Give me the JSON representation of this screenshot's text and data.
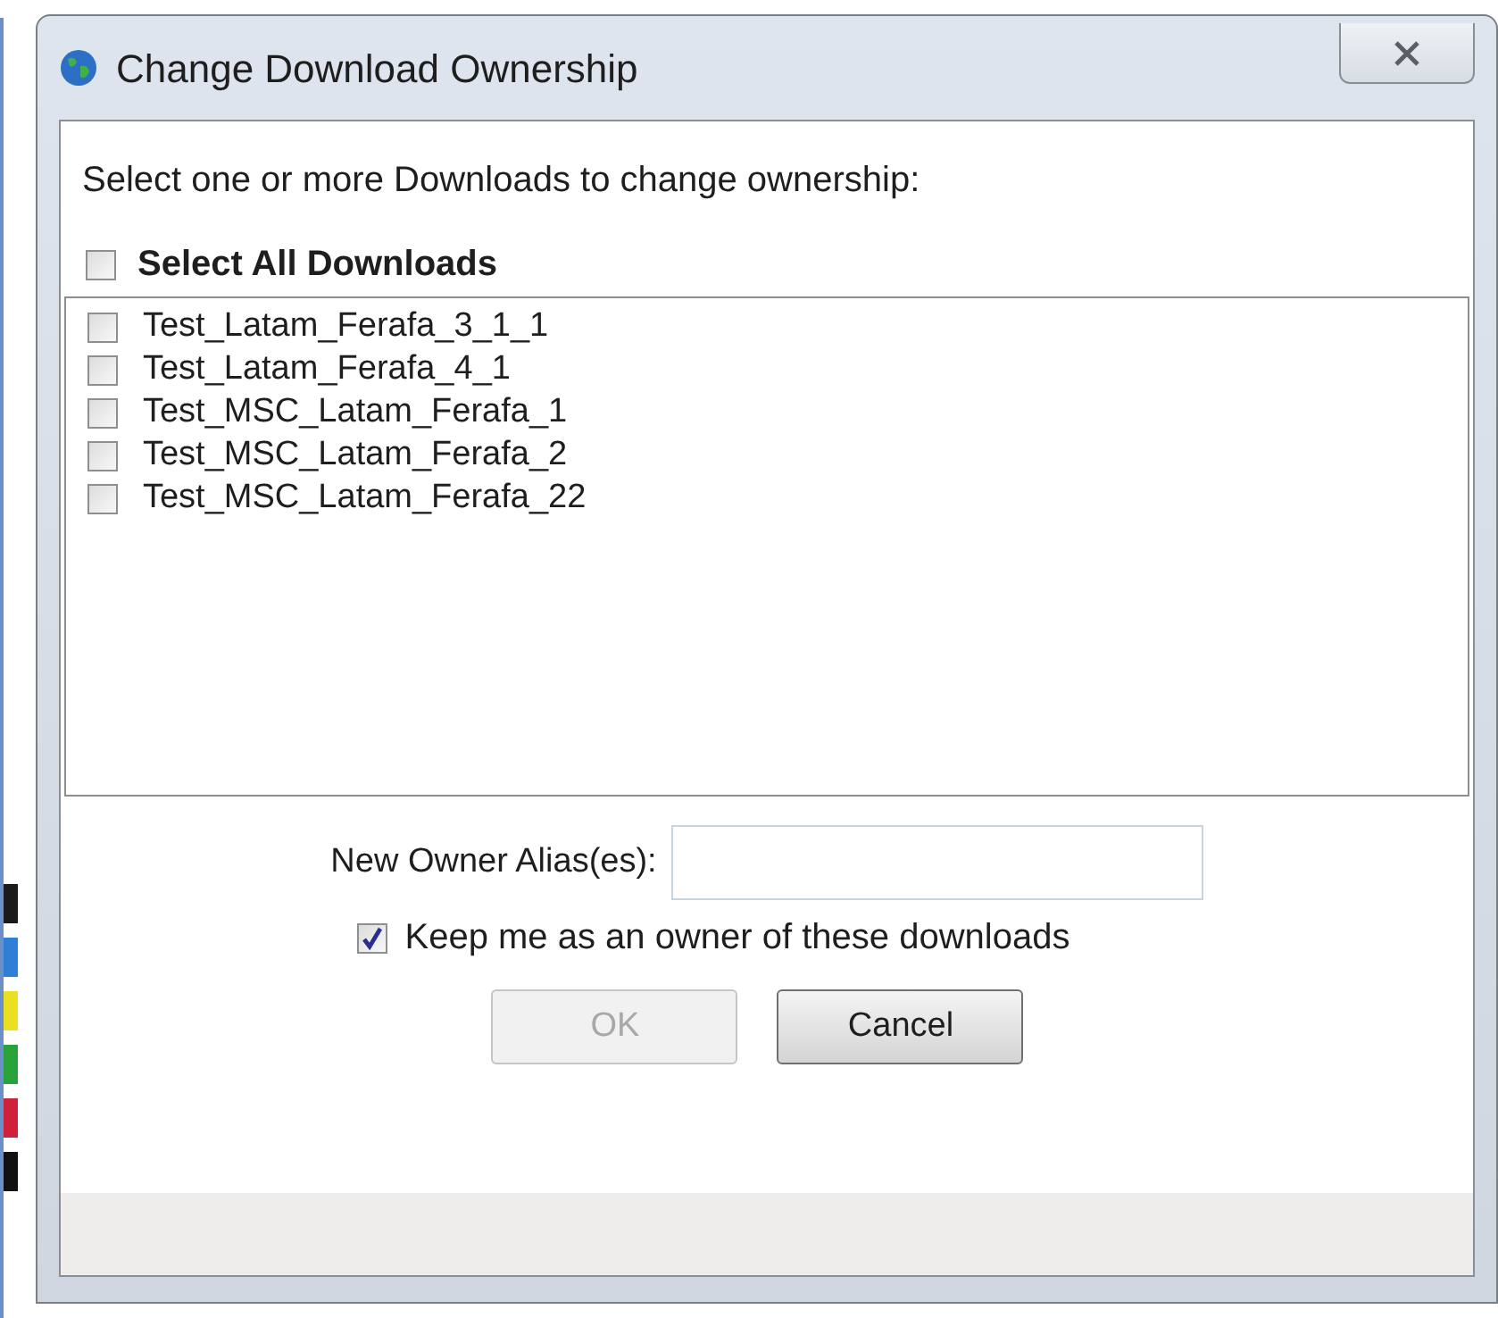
{
  "window": {
    "title": "Change Download Ownership"
  },
  "instruction": "Select one or more Downloads to change ownership:",
  "select_all": {
    "label": "Select All Downloads",
    "checked": false
  },
  "downloads": [
    {
      "name": "Test_Latam_Ferafa_3_1_1",
      "checked": false
    },
    {
      "name": "Test_Latam_Ferafa_4_1",
      "checked": false
    },
    {
      "name": "Test_MSC_Latam_Ferafa_1",
      "checked": false
    },
    {
      "name": "Test_MSC_Latam_Ferafa_2",
      "checked": false
    },
    {
      "name": "Test_MSC_Latam_Ferafa_22",
      "checked": false
    }
  ],
  "owner_field": {
    "label": "New Owner Alias(es):"
  },
  "keep_owner": {
    "label": "Keep me as an owner of these downloads",
    "checked": true
  },
  "buttons": [
    {
      "label": "OK",
      "disabled": true
    },
    {
      "label": "Cancel",
      "disabled": false
    }
  ]
}
